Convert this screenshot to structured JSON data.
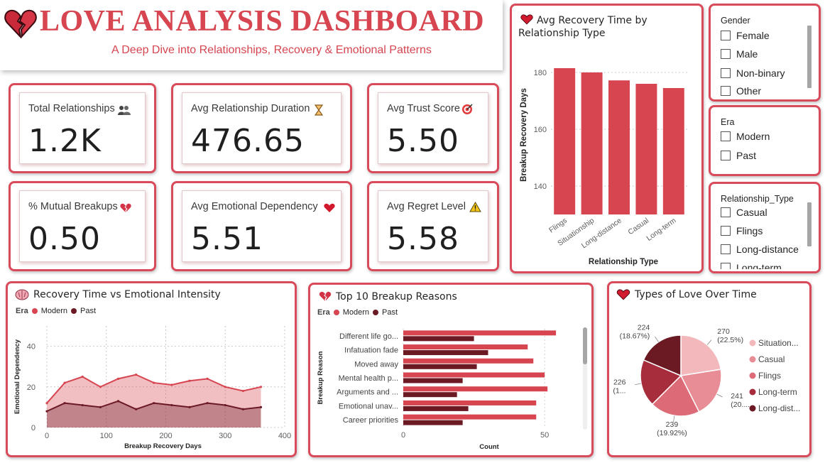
{
  "header": {
    "title": "LOVE ANALYSIS DASHBOARD",
    "subtitle": "A Deep Dive into Relationships, Recovery & Emotional Patterns",
    "icon": "broken-heart-icon"
  },
  "kpis": [
    {
      "label": "Total Relationships",
      "value": "1.2K",
      "icon": "people-icon"
    },
    {
      "label": "Avg Relationship Duration",
      "value": "476.65",
      "icon": "hourglass-icon"
    },
    {
      "label": "Avg Trust Score",
      "value": "5.50",
      "icon": "target-icon"
    },
    {
      "label": "% Mutual Breakups",
      "value": "0.50",
      "icon": "broken-heart-icon"
    },
    {
      "label": "Avg Emotional Dependency",
      "value": "5.51",
      "icon": "heart-icon"
    },
    {
      "label": "Avg Regret Level",
      "value": "5.58",
      "icon": "warning-icon"
    }
  ],
  "slicers": {
    "gender": {
      "title": "Gender",
      "options": [
        "Female",
        "Male",
        "Non-binary",
        "Other"
      ]
    },
    "era": {
      "title": "Era",
      "options": [
        "Modern",
        "Past"
      ]
    },
    "relationship_type": {
      "title": "Relationship_Type",
      "options": [
        "Casual",
        "Flings",
        "Long-distance",
        "Long-term"
      ]
    }
  },
  "colors": {
    "accent": "#d94a5a",
    "modern": "#d64550",
    "past": "#6b1a24",
    "bar": "#d64550",
    "pie": [
      "#f2b8bc",
      "#e88d95",
      "#dc6b77",
      "#a72c3c",
      "#6b1a24"
    ]
  },
  "charts": {
    "recovery_by_type": {
      "title": "Avg Recovery Time by Relationship Type",
      "icon": "heart-icon",
      "xlabel": "Relationship Type",
      "ylabel": "Breakup Recovery Days"
    },
    "recovery_vs_emotion": {
      "title": "Recovery Time vs Emotional Intensity",
      "icon": "brain-icon",
      "legend_title": "Era",
      "legend": [
        "Modern",
        "Past"
      ],
      "xlabel": "Breakup Recovery Days",
      "ylabel": "Emotional Dependency"
    },
    "breakup_reasons": {
      "title": "Top 10 Breakup Reasons",
      "icon": "broken-heart-icon",
      "legend_title": "Era",
      "legend": [
        "Modern",
        "Past"
      ],
      "xlabel": "Count",
      "ylabel": "Breakup Reason"
    },
    "love_types": {
      "title": "Types of Love Over Time",
      "icon": "heart-icon",
      "legend": [
        "Situation...",
        "Casual",
        "Flings",
        "Long-term",
        "Long-dist..."
      ],
      "labels": [
        {
          "value": "270",
          "pct": "(22.5%)"
        },
        {
          "value": "241",
          "pct": "(20...."
        },
        {
          "value": "239",
          "pct": "(19.92%)"
        },
        {
          "value": "226",
          "pct": "(1..."
        },
        {
          "value": "224",
          "pct": "(18.67%)"
        }
      ]
    }
  },
  "chart_data": [
    {
      "type": "bar",
      "title": "Avg Recovery Time by Relationship Type",
      "categories": [
        "Flings",
        "Situationship",
        "Long-distance",
        "Casual",
        "Long-term"
      ],
      "values": [
        181.5,
        180,
        177.2,
        176,
        174.5
      ],
      "xlabel": "Relationship Type",
      "ylabel": "Breakup Recovery Days",
      "ylim": [
        130,
        186
      ],
      "yticks": [
        140,
        160,
        180
      ],
      "grid": true
    },
    {
      "type": "line",
      "title": "Recovery Time vs Emotional Intensity",
      "xlabel": "Breakup Recovery Days",
      "ylabel": "Emotional Dependency",
      "xlim": [
        0,
        400
      ],
      "ylim": [
        0,
        50
      ],
      "xticks": [
        0,
        100,
        200,
        300,
        400
      ],
      "yticks": [
        0,
        20,
        40
      ],
      "series": [
        {
          "name": "Modern",
          "x": [
            0,
            30,
            60,
            90,
            120,
            150,
            180,
            210,
            240,
            270,
            300,
            330,
            360
          ],
          "values": [
            12,
            22,
            25,
            20,
            24,
            26,
            22,
            21,
            23,
            24,
            20,
            18,
            20
          ]
        },
        {
          "name": "Past",
          "x": [
            0,
            30,
            60,
            90,
            120,
            150,
            180,
            210,
            240,
            270,
            300,
            330,
            360
          ],
          "values": [
            8,
            12,
            11,
            10,
            13,
            9,
            12,
            11,
            10,
            12,
            11,
            9,
            10
          ]
        }
      ]
    },
    {
      "type": "bar",
      "title": "Top 10 Breakup Reasons",
      "categories": [
        "Different life go...",
        "Infatuation fade",
        "Moved away",
        "Mental health p...",
        "Arguments and ...",
        "Emotional unav...",
        "Career priorities"
      ],
      "xlabel": "Count",
      "ylabel": "Breakup Reason",
      "xlim": [
        0,
        60
      ],
      "xticks": [
        0,
        50
      ],
      "series": [
        {
          "name": "Modern",
          "values": [
            54,
            44,
            46,
            50,
            51,
            47,
            47
          ]
        },
        {
          "name": "Past",
          "values": [
            25,
            30,
            26,
            21,
            19,
            23,
            21
          ]
        }
      ]
    },
    {
      "type": "pie",
      "title": "Types of Love Over Time",
      "categories": [
        "Situationship",
        "Casual",
        "Flings",
        "Long-term",
        "Long-distance"
      ],
      "values": [
        270,
        241,
        239,
        226,
        224
      ]
    }
  ]
}
